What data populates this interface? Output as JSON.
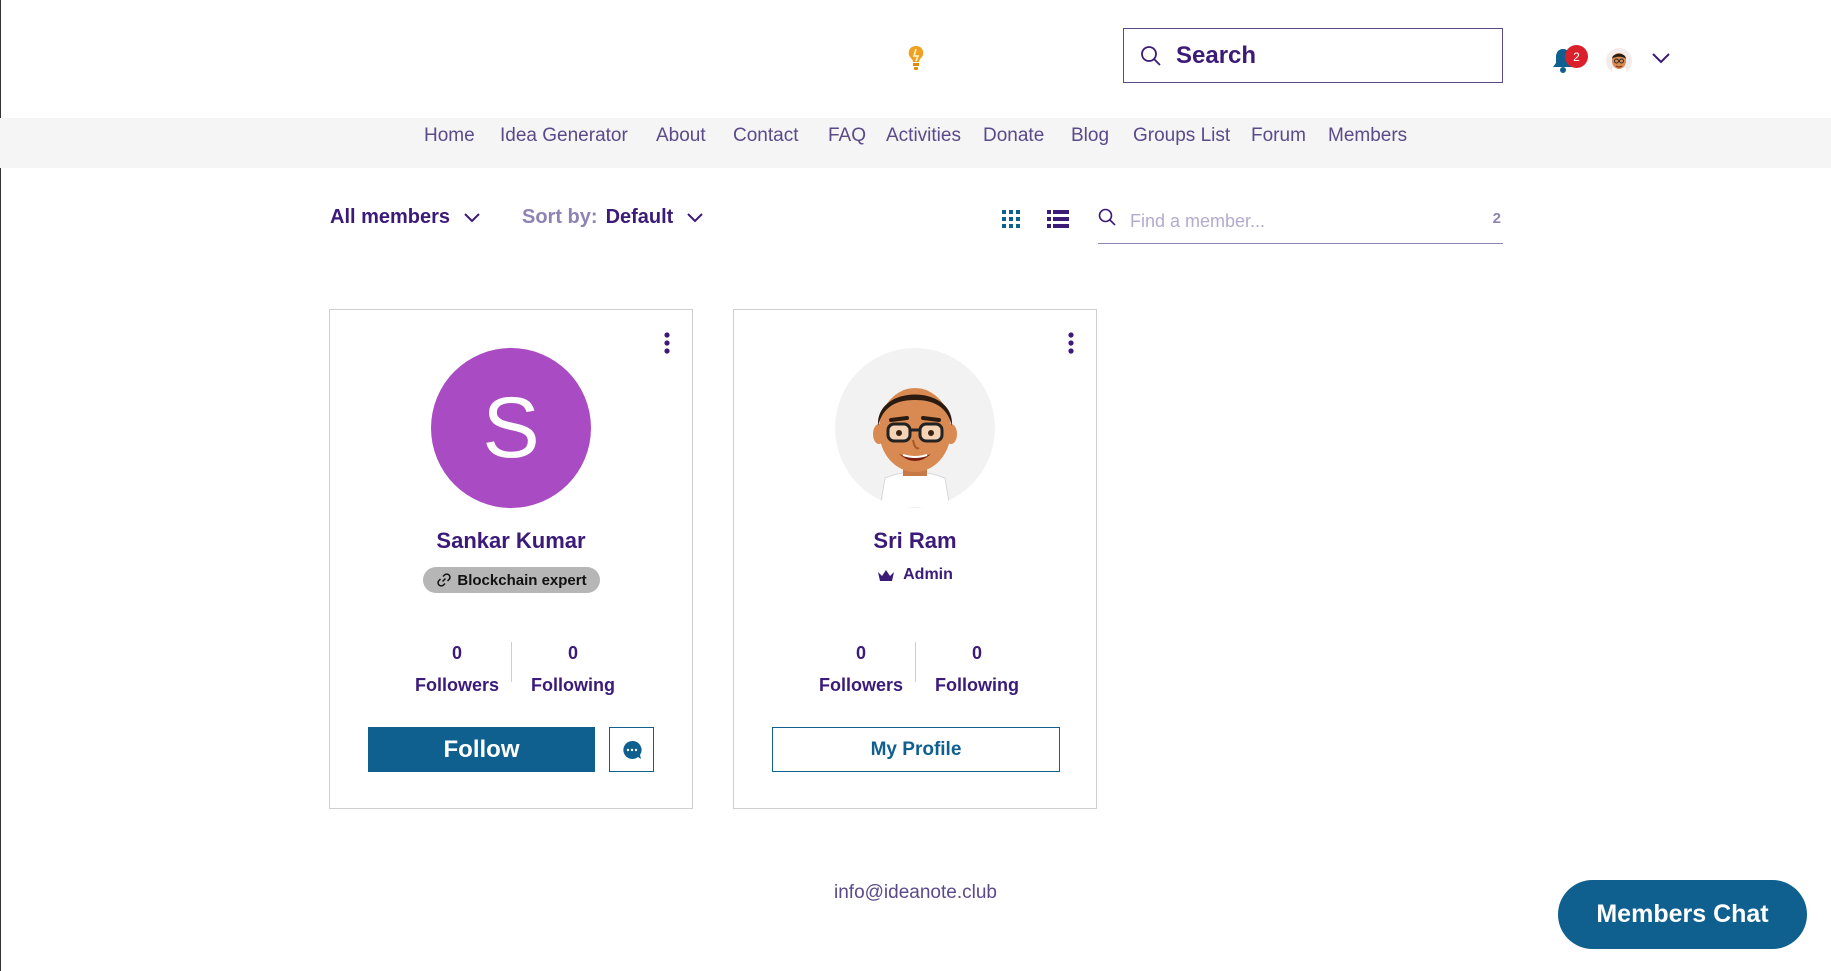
{
  "header": {
    "logo_icon": "lightbulb-logo-icon",
    "search": {
      "label": "Search",
      "icon": "search-icon"
    },
    "notifications": {
      "icon": "bell-icon",
      "count": "2"
    },
    "account": {
      "icon": "user-avatar",
      "chevron": "chevron-down-icon"
    }
  },
  "nav": {
    "items": [
      {
        "label": "Home"
      },
      {
        "label": "Idea Generator"
      },
      {
        "label": "About"
      },
      {
        "label": "Contact"
      },
      {
        "label": "FAQ"
      },
      {
        "label": "Activities"
      },
      {
        "label": "Donate"
      },
      {
        "label": "Blog"
      },
      {
        "label": "Groups List"
      },
      {
        "label": "Forum"
      },
      {
        "label": "Members"
      }
    ]
  },
  "toolbar": {
    "filter_label": "All members",
    "sort_label": "Sort by:",
    "sort_value": "Default",
    "view_grid_icon": "grid-view-icon",
    "view_list_icon": "list-view-icon",
    "member_search_placeholder": "Find a member...",
    "member_count": "2"
  },
  "members": [
    {
      "name": "Sankar Kumar",
      "avatar_letter": "S",
      "avatar_color": "#a94bc2",
      "badge": "Blockchain expert",
      "followers_count": "0",
      "followers_label": "Followers",
      "following_count": "0",
      "following_label": "Following",
      "primary_action": "Follow"
    },
    {
      "name": "Sri Ram",
      "role": "Admin",
      "followers_count": "0",
      "followers_label": "Followers",
      "following_count": "0",
      "following_label": "Following",
      "primary_action": "My Profile"
    }
  ],
  "footer": {
    "email": "info@ideanote.club",
    "chat_button": "Members Chat"
  },
  "colors": {
    "primary_text": "#3b1a78",
    "muted_text": "#8f83b3",
    "button_blue": "#0f5f8f",
    "notification_red": "#d9202b"
  }
}
